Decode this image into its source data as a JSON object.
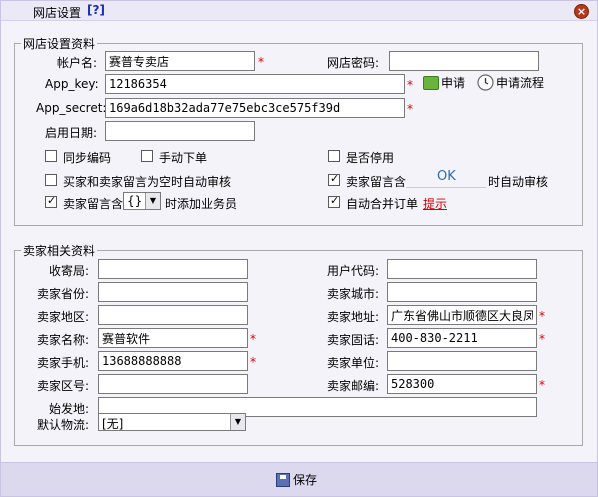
{
  "title": "网店设置",
  "help": "[?]",
  "close_icon": "×",
  "shop": {
    "legend": "网店设置资料",
    "account_label": "帐户名:",
    "account_value": "赛普专卖店",
    "password_label": "网店密码:",
    "password_value": "",
    "appkey_label": "App_key:",
    "appkey_value": "12186354",
    "apply_label": "申请",
    "flow_label": "申请流程",
    "appsecret_label": "App_secret:",
    "appsecret_value": "169a6d18b32ada77e75ebc3ce575f39d",
    "enable_date_label": "启用日期:",
    "enable_date_value": "",
    "required_mark": "*",
    "sync_code": "同步编码",
    "manual_order": "手动下单",
    "disabled": "是否停用",
    "auto_audit_empty": "买家和卖家留言为空时自动审核",
    "seller_msg_contains_1": "卖家留言含",
    "ok_text": "OK",
    "auto_audit_suffix": "时自动审核",
    "seller_msg_contains_2": "卖家留言含",
    "brace_select": "{}",
    "add_staff_suffix": "时添加业务员",
    "auto_merge": "自动合并订单",
    "hint_link": "提示",
    "checkboxes": {
      "sync_code": false,
      "manual_order": false,
      "disabled": false,
      "auto_audit_empty": false,
      "seller_msg_audit": true,
      "seller_msg_staff": true,
      "auto_merge": true
    }
  },
  "seller": {
    "legend": "卖家相关资料",
    "post_office_label": "收寄局:",
    "post_office_value": "",
    "user_code_label": "用户代码:",
    "user_code_value": "",
    "province_label": "卖家省份:",
    "province_value": "",
    "city_label": "卖家城市:",
    "city_value": "",
    "district_label": "卖家地区:",
    "district_value": "",
    "address_label": "卖家地址:",
    "address_value": "广东省佛山市顺德区大良凤",
    "name_label": "卖家名称:",
    "name_value": "赛普软件",
    "phone_label": "卖家固话:",
    "phone_value": "400-830-2211",
    "mobile_label": "卖家手机:",
    "mobile_value": "13688888888",
    "unit_label": "卖家单位:",
    "unit_value": "",
    "area_code_label": "卖家区号:",
    "area_code_value": "",
    "postcode_label": "卖家邮编:",
    "postcode_value": "528300",
    "origin_label": "始发地:",
    "origin_value": "",
    "logistics_label": "默认物流:",
    "logistics_value": "[无]"
  },
  "save_label": "保存",
  "colors": {
    "required": "#e00000",
    "link": "#d40000",
    "accent": "#1b2fb0"
  }
}
